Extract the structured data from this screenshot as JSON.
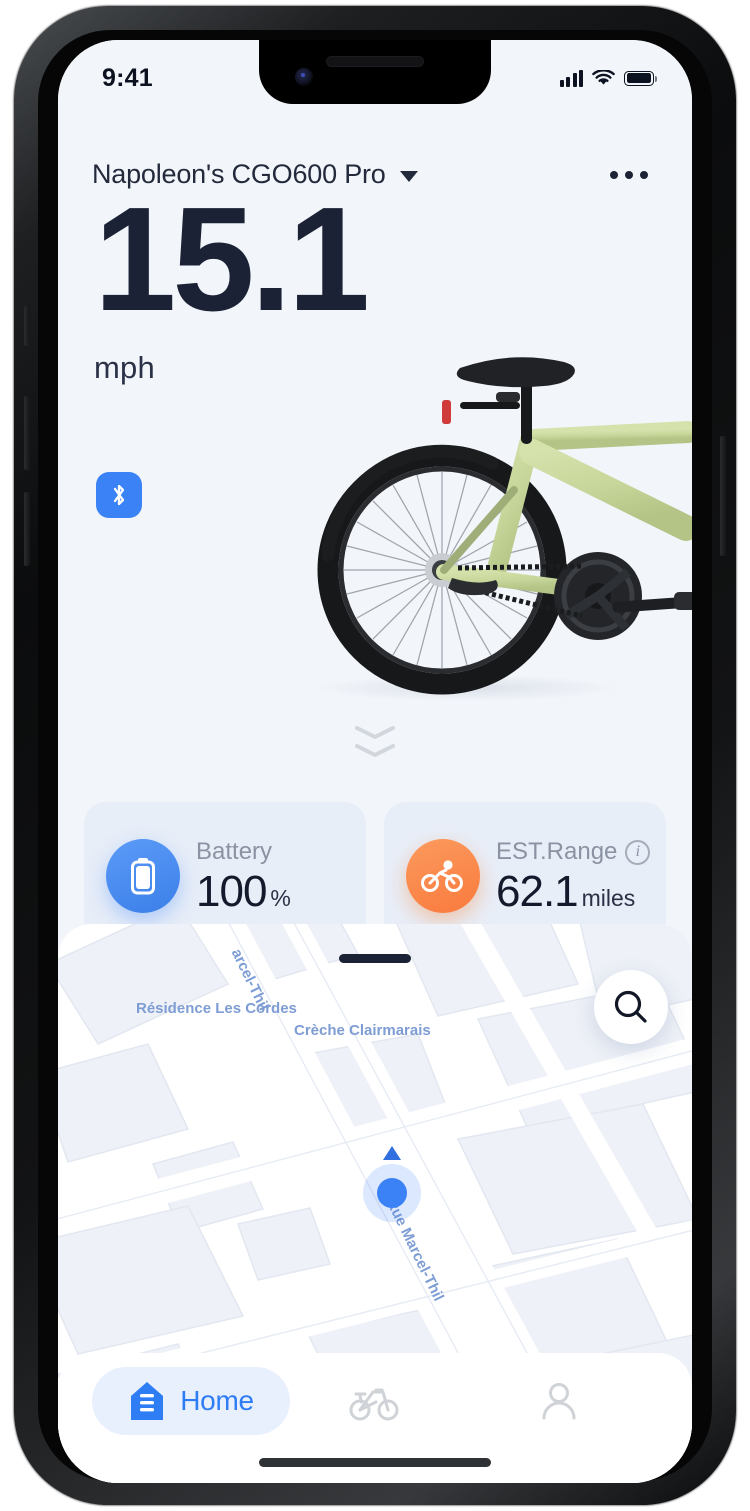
{
  "status_bar": {
    "time": "9:41",
    "signal_icon": "cellular-signal-icon",
    "wifi_icon": "wifi-icon",
    "battery_icon": "battery-icon"
  },
  "header": {
    "device_name": "Napoleon's CGO600 Pro",
    "dropdown_icon": "chevron-down-icon",
    "more_icon": "more-options-icon"
  },
  "speed": {
    "value": "15.1",
    "unit": "mph",
    "bluetooth_icon": "bluetooth-icon"
  },
  "bike": {
    "image_name": "ebike-illustration",
    "frame_color": "#c8d69a",
    "scroll_hint_icon": "double-chevron-down-icon"
  },
  "stats": [
    {
      "id": "battery",
      "label": "Battery",
      "value": "100",
      "unit": "%",
      "icon": "battery-icon",
      "icon_color": "#3b82f6",
      "has_info": false
    },
    {
      "id": "est-range",
      "label": "EST.Range",
      "value": "62.1",
      "unit": "miles",
      "icon": "cyclist-icon",
      "icon_color": "#f97a3d",
      "has_info": true,
      "info_icon": "info-icon",
      "info_glyph": "i"
    }
  ],
  "map": {
    "handle_name": "drag-handle",
    "search_icon": "search-icon",
    "labels": {
      "residence": "Résidence Les Cordes",
      "creche": "Crèche Clairmarais",
      "street_top": "arcel-Thil",
      "street_mid": "Rue Marcel-Thil"
    },
    "user_location": {
      "marker_name": "user-location-marker",
      "heading_icon": "heading-triangle-icon",
      "dot_color": "#3b82f6"
    }
  },
  "bottom_nav": {
    "items": [
      {
        "id": "home",
        "label": "Home",
        "icon": "home-icon",
        "active": true
      },
      {
        "id": "bike",
        "label": "",
        "icon": "bike-icon",
        "active": false
      },
      {
        "id": "profile",
        "label": "",
        "icon": "person-icon",
        "active": false
      }
    ],
    "active_color": "#2f7df5"
  },
  "theme": {
    "app_background": "#f2f5fa",
    "card_background": "#e8eef8",
    "text_primary": "#1b2236",
    "text_muted": "#8b93a3",
    "accent_blue": "#3b82f6",
    "accent_orange": "#f97a3d",
    "map_label_blue": "#7e9dd4"
  }
}
